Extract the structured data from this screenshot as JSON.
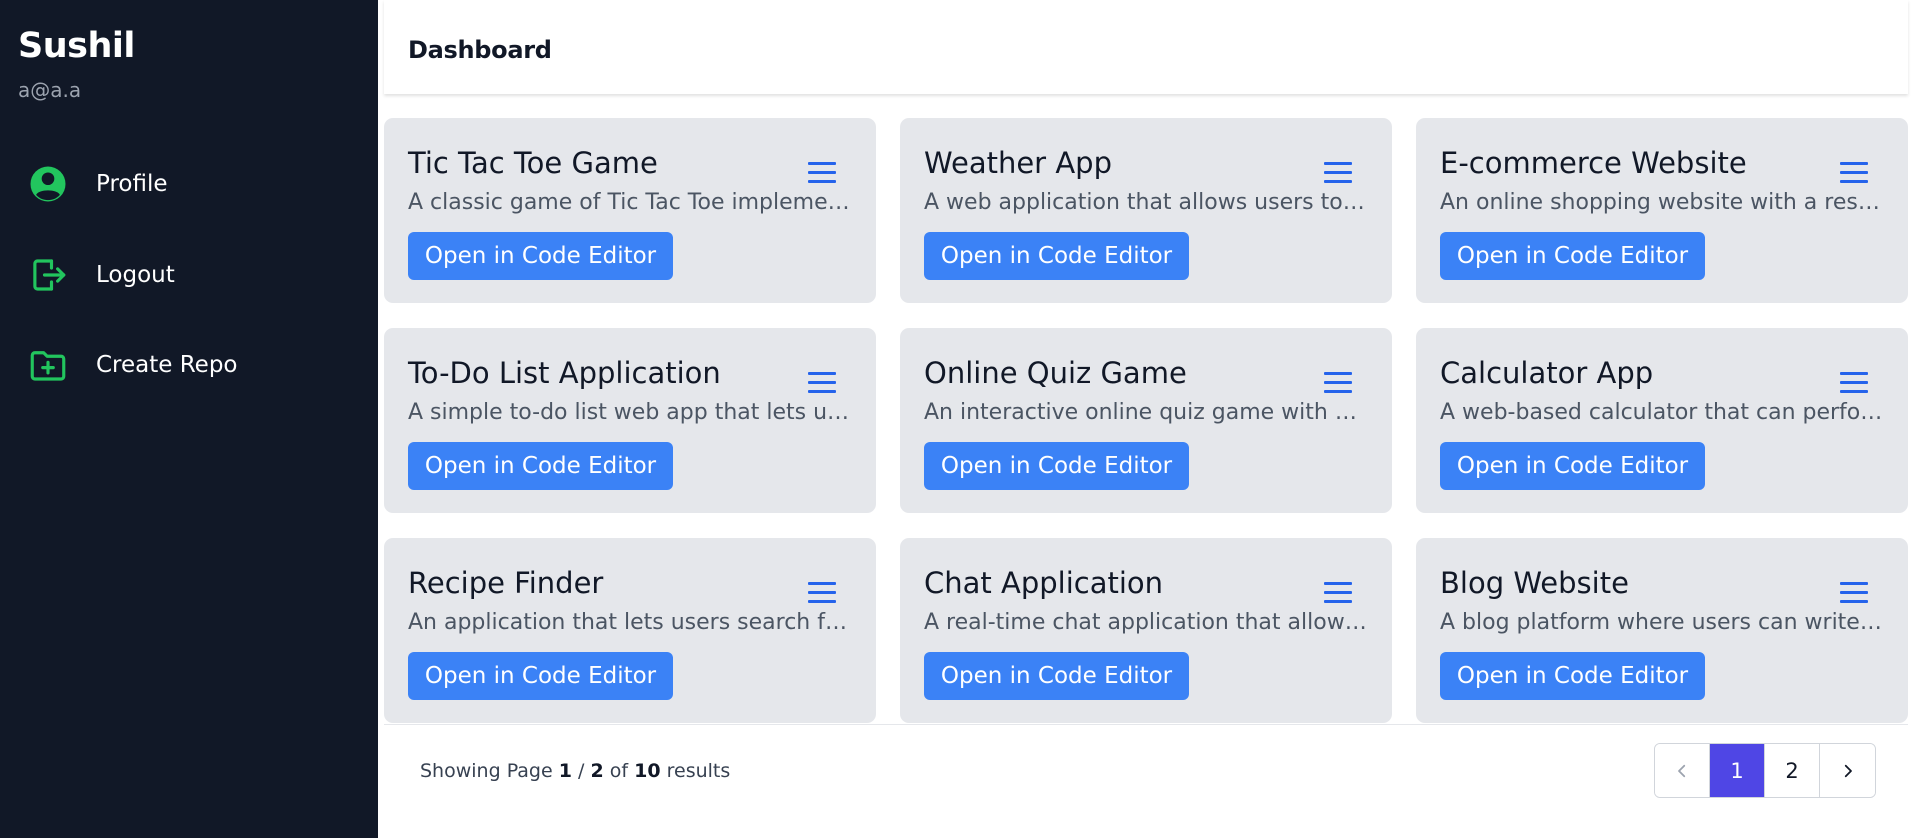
{
  "user": {
    "name": "Sushil",
    "email": "a@a.a"
  },
  "nav": [
    {
      "label": "Profile",
      "icon": "profile-icon"
    },
    {
      "label": "Logout",
      "icon": "logout-icon"
    },
    {
      "label": "Create Repo",
      "icon": "folder-plus-icon"
    }
  ],
  "header": {
    "title": "Dashboard"
  },
  "colors": {
    "sidebar": "#111827",
    "accent": "#3b82f6",
    "icon_green": "#22c55e",
    "menu_blue": "#2563eb",
    "active_page": "#4f46e5"
  },
  "cards": [
    {
      "title": "Tic Tac Toe Game",
      "description": "A classic game of Tic Tac Toe implemented",
      "button": "Open in Code Editor"
    },
    {
      "title": "Weather App",
      "description": "A web application that allows users to check",
      "button": "Open in Code Editor"
    },
    {
      "title": "E-commerce Website",
      "description": "An online shopping website with a responsive",
      "button": "Open in Code Editor"
    },
    {
      "title": "To-Do List Application",
      "description": "A simple to-do list web app that lets users",
      "button": "Open in Code Editor"
    },
    {
      "title": "Online Quiz Game",
      "description": "An interactive online quiz game with multiple",
      "button": "Open in Code Editor"
    },
    {
      "title": "Calculator App",
      "description": "A web-based calculator that can perform",
      "button": "Open in Code Editor"
    },
    {
      "title": "Recipe Finder",
      "description": "An application that lets users search for recipes",
      "button": "Open in Code Editor"
    },
    {
      "title": "Chat Application",
      "description": "A real-time chat application that allows users",
      "button": "Open in Code Editor"
    },
    {
      "title": "Blog Website",
      "description": "A blog platform where users can write and",
      "button": "Open in Code Editor"
    }
  ],
  "pagination": {
    "prefix": "Showing Page",
    "current": "1",
    "separator": "/",
    "total_pages": "2",
    "of": "of",
    "total_results": "10",
    "suffix": "results",
    "pages": [
      "1",
      "2"
    ]
  }
}
